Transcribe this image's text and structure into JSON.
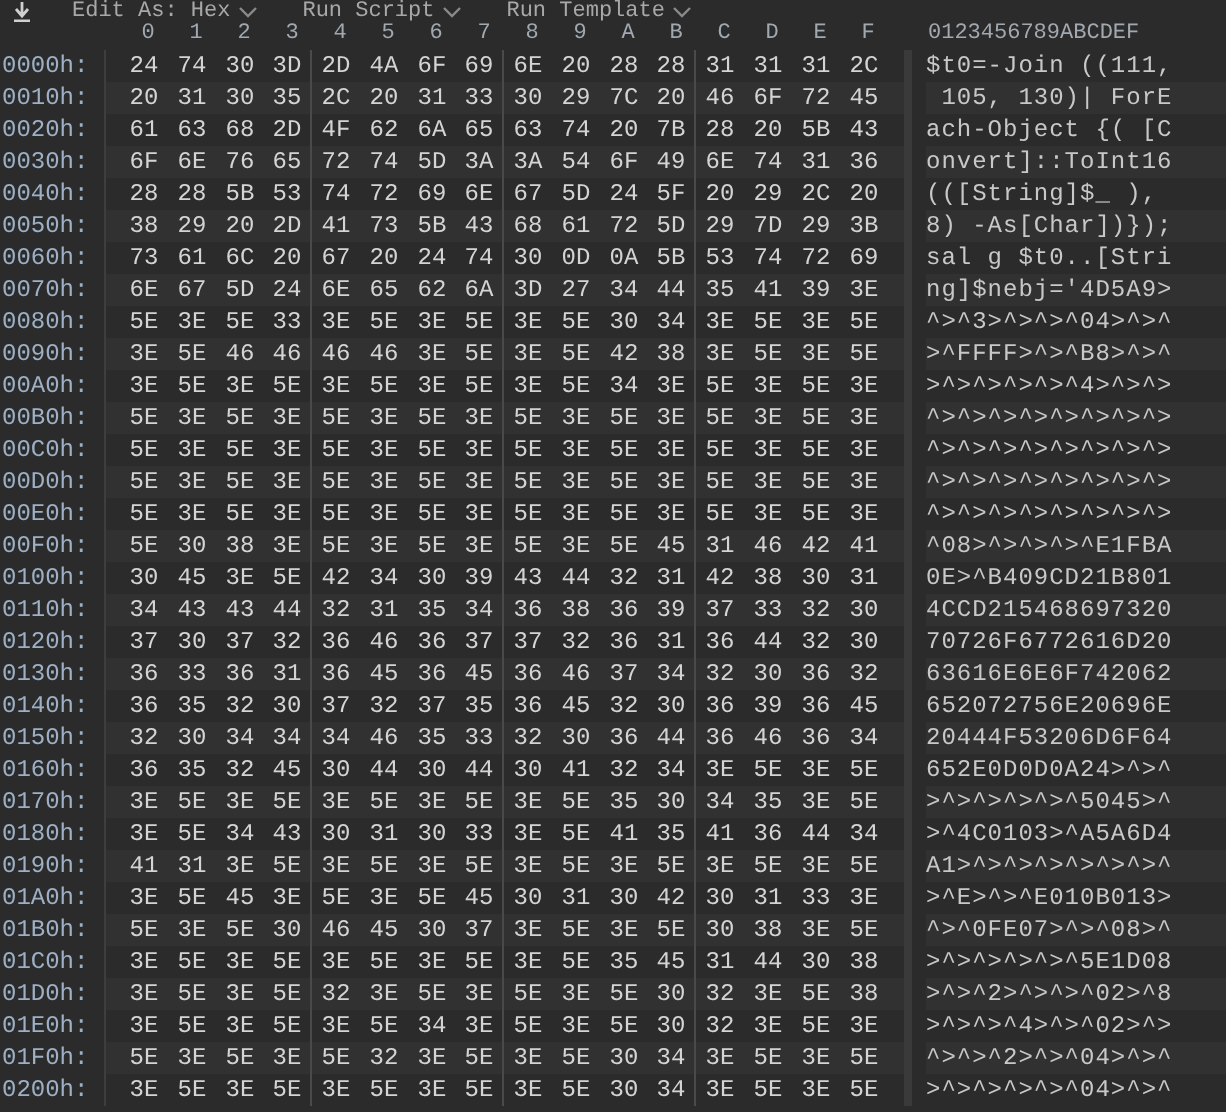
{
  "toolbar": {
    "menus": [
      {
        "label": "Edit As: Hex"
      },
      {
        "label": "Run Script"
      },
      {
        "label": "Run Template"
      }
    ]
  },
  "columns": [
    "0",
    "1",
    "2",
    "3",
    "4",
    "5",
    "6",
    "7",
    "8",
    "9",
    "A",
    "B",
    "C",
    "D",
    "E",
    "F"
  ],
  "ascii_header": "0123456789ABCDEF",
  "rows": [
    {
      "address": "0000h:",
      "bytes": "24 74 30 3D 2D 4A 6F 69 6E 20 28 28 31 31 31 2C",
      "ascii": "$t0=-Join ((111,"
    },
    {
      "address": "0010h:",
      "bytes": "20 31 30 35 2C 20 31 33 30 29 7C 20 46 6F 72 45",
      "ascii": " 105, 130)| ForE"
    },
    {
      "address": "0020h:",
      "bytes": "61 63 68 2D 4F 62 6A 65 63 74 20 7B 28 20 5B 43",
      "ascii": "ach-Object {( [C"
    },
    {
      "address": "0030h:",
      "bytes": "6F 6E 76 65 72 74 5D 3A 3A 54 6F 49 6E 74 31 36",
      "ascii": "onvert]::ToInt16"
    },
    {
      "address": "0040h:",
      "bytes": "28 28 5B 53 74 72 69 6E 67 5D 24 5F 20 29 2C 20",
      "ascii": "(([String]$_ ), "
    },
    {
      "address": "0050h:",
      "bytes": "38 29 20 2D 41 73 5B 43 68 61 72 5D 29 7D 29 3B",
      "ascii": "8) -As[Char])});"
    },
    {
      "address": "0060h:",
      "bytes": "73 61 6C 20 67 20 24 74 30 0D 0A 5B 53 74 72 69",
      "ascii": "sal g $t0..[Stri"
    },
    {
      "address": "0070h:",
      "bytes": "6E 67 5D 24 6E 65 62 6A 3D 27 34 44 35 41 39 3E",
      "ascii": "ng]$nebj='4D5A9>"
    },
    {
      "address": "0080h:",
      "bytes": "5E 3E 5E 33 3E 5E 3E 5E 3E 5E 30 34 3E 5E 3E 5E",
      "ascii": "^>^3>^>^>^04>^>^"
    },
    {
      "address": "0090h:",
      "bytes": "3E 5E 46 46 46 46 3E 5E 3E 5E 42 38 3E 5E 3E 5E",
      "ascii": ">^FFFF>^>^B8>^>^"
    },
    {
      "address": "00A0h:",
      "bytes": "3E 5E 3E 5E 3E 5E 3E 5E 3E 5E 34 3E 5E 3E 5E 3E",
      "ascii": ">^>^>^>^>^4>^>^>"
    },
    {
      "address": "00B0h:",
      "bytes": "5E 3E 5E 3E 5E 3E 5E 3E 5E 3E 5E 3E 5E 3E 5E 3E",
      "ascii": "^>^>^>^>^>^>^>^>"
    },
    {
      "address": "00C0h:",
      "bytes": "5E 3E 5E 3E 5E 3E 5E 3E 5E 3E 5E 3E 5E 3E 5E 3E",
      "ascii": "^>^>^>^>^>^>^>^>"
    },
    {
      "address": "00D0h:",
      "bytes": "5E 3E 5E 3E 5E 3E 5E 3E 5E 3E 5E 3E 5E 3E 5E 3E",
      "ascii": "^>^>^>^>^>^>^>^>"
    },
    {
      "address": "00E0h:",
      "bytes": "5E 3E 5E 3E 5E 3E 5E 3E 5E 3E 5E 3E 5E 3E 5E 3E",
      "ascii": "^>^>^>^>^>^>^>^>"
    },
    {
      "address": "00F0h:",
      "bytes": "5E 30 38 3E 5E 3E 5E 3E 5E 3E 5E 45 31 46 42 41",
      "ascii": "^08>^>^>^>^E1FBA"
    },
    {
      "address": "0100h:",
      "bytes": "30 45 3E 5E 42 34 30 39 43 44 32 31 42 38 30 31",
      "ascii": "0E>^B409CD21B801"
    },
    {
      "address": "0110h:",
      "bytes": "34 43 43 44 32 31 35 34 36 38 36 39 37 33 32 30",
      "ascii": "4CCD215468697320"
    },
    {
      "address": "0120h:",
      "bytes": "37 30 37 32 36 46 36 37 37 32 36 31 36 44 32 30",
      "ascii": "70726F6772616D20"
    },
    {
      "address": "0130h:",
      "bytes": "36 33 36 31 36 45 36 45 36 46 37 34 32 30 36 32",
      "ascii": "63616E6E6F742062"
    },
    {
      "address": "0140h:",
      "bytes": "36 35 32 30 37 32 37 35 36 45 32 30 36 39 36 45",
      "ascii": "652072756E20696E"
    },
    {
      "address": "0150h:",
      "bytes": "32 30 34 34 34 46 35 33 32 30 36 44 36 46 36 34",
      "ascii": "20444F53206D6F64"
    },
    {
      "address": "0160h:",
      "bytes": "36 35 32 45 30 44 30 44 30 41 32 34 3E 5E 3E 5E",
      "ascii": "652E0D0D0A24>^>^"
    },
    {
      "address": "0170h:",
      "bytes": "3E 5E 3E 5E 3E 5E 3E 5E 3E 5E 35 30 34 35 3E 5E",
      "ascii": ">^>^>^>^>^5045>^"
    },
    {
      "address": "0180h:",
      "bytes": "3E 5E 34 43 30 31 30 33 3E 5E 41 35 41 36 44 34",
      "ascii": ">^4C0103>^A5A6D4"
    },
    {
      "address": "0190h:",
      "bytes": "41 31 3E 5E 3E 5E 3E 5E 3E 5E 3E 5E 3E 5E 3E 5E",
      "ascii": "A1>^>^>^>^>^>^>^"
    },
    {
      "address": "01A0h:",
      "bytes": "3E 5E 45 3E 5E 3E 5E 45 30 31 30 42 30 31 33 3E",
      "ascii": ">^E>^>^E010B013>"
    },
    {
      "address": "01B0h:",
      "bytes": "5E 3E 5E 30 46 45 30 37 3E 5E 3E 5E 30 38 3E 5E",
      "ascii": "^>^0FE07>^>^08>^"
    },
    {
      "address": "01C0h:",
      "bytes": "3E 5E 3E 5E 3E 5E 3E 5E 3E 5E 35 45 31 44 30 38",
      "ascii": ">^>^>^>^>^5E1D08"
    },
    {
      "address": "01D0h:",
      "bytes": "3E 5E 3E 5E 32 3E 5E 3E 5E 3E 5E 30 32 3E 5E 38",
      "ascii": ">^>^2>^>^>^02>^8"
    },
    {
      "address": "01E0h:",
      "bytes": "3E 5E 3E 5E 3E 5E 34 3E 5E 3E 5E 30 32 3E 5E 3E",
      "ascii": ">^>^>^4>^>^02>^>"
    },
    {
      "address": "01F0h:",
      "bytes": "5E 3E 5E 3E 5E 32 3E 5E 3E 5E 30 34 3E 5E 3E 5E",
      "ascii": "^>^>^2>^>^04>^>^"
    },
    {
      "address": "0200h:",
      "bytes": "3E 5E 3E 5E 3E 5E 3E 5E 3E 5E 30 34 3E 5E 3E 5E",
      "ascii": ">^>^>^>^>^04>^>^"
    }
  ]
}
